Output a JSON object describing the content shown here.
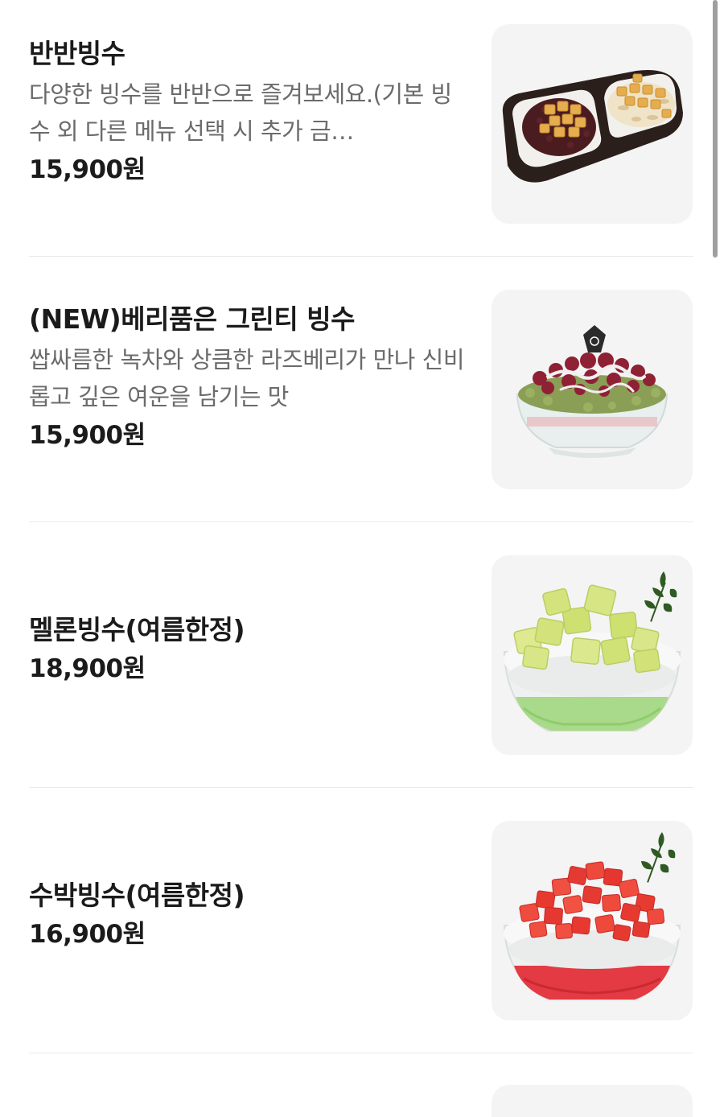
{
  "menu": {
    "items": [
      {
        "name": "반반빙수",
        "description": "다양한 빙수를 반반으로 즐겨보세요.(기본 빙수 외 다른 메뉴 선택 시 추가 금…",
        "price": "15,900원"
      },
      {
        "name": "(NEW)베리품은 그린티 빙수",
        "description": "쌉싸름한 녹차와 상큼한 라즈베리가 만나 신비롭고 깊은 여운을 남기는 맛",
        "price": "15,900원"
      },
      {
        "name": "멜론빙수(여름한정)",
        "price": "18,900원"
      },
      {
        "name": "수박빙수(여름한정)",
        "price": "16,900원"
      }
    ]
  },
  "colors": {
    "text_primary": "#1b1b1b",
    "text_secondary": "#6b6b6b",
    "thumb_background": "#f4f4f4",
    "divider": "#ebebeb"
  }
}
